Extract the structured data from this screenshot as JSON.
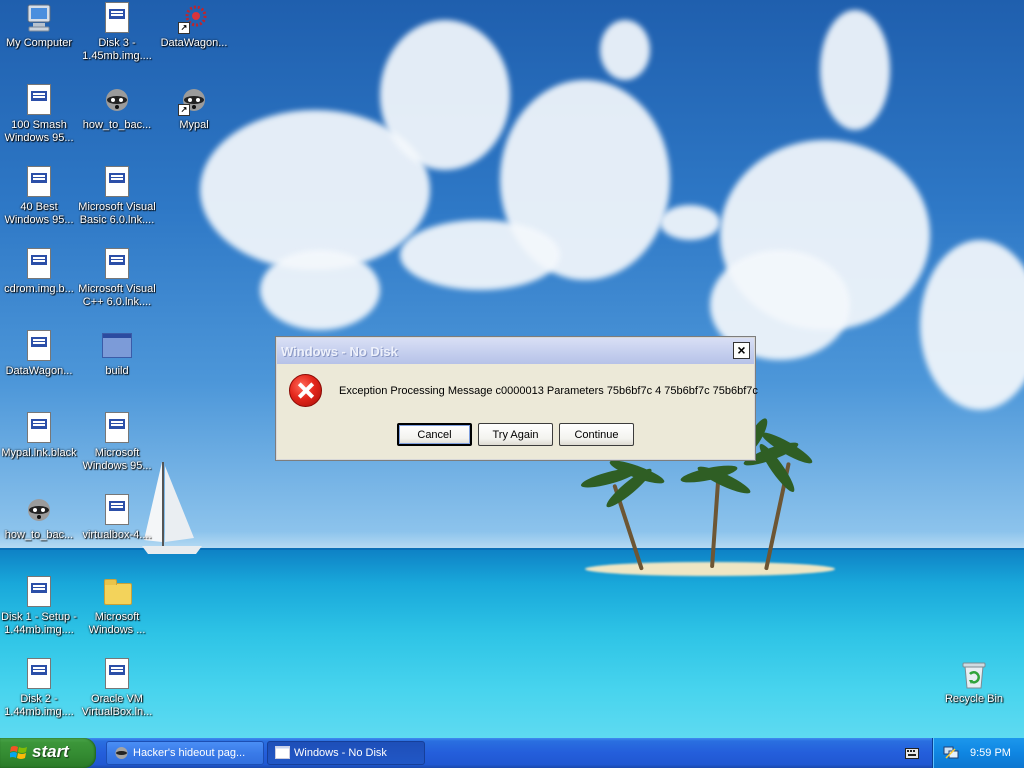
{
  "desktop": {
    "icons": [
      {
        "label": "My Computer",
        "type": "computer"
      },
      {
        "label": "100 Smash\nWindows 95...",
        "type": "doc"
      },
      {
        "label": "40 Best\nWindows 95...",
        "type": "doc"
      },
      {
        "label": "cdrom.img.b...",
        "type": "doc"
      },
      {
        "label": "DataWagon...",
        "type": "doc"
      },
      {
        "label": "Mypal.lnk.black",
        "type": "doc"
      },
      {
        "label": "how_to_bac...",
        "type": "raccoon"
      },
      {
        "label": "Disk 1 - Setup -\n1.44mb.img....",
        "type": "doc"
      },
      {
        "label": "Disk 2 -\n1.44mb.img....",
        "type": "doc"
      },
      {
        "label": "Disk 3 -\n1.45mb.img....",
        "type": "doc"
      },
      {
        "label": "how_to_bac...",
        "type": "raccoon"
      },
      {
        "label": "Microsoft Visual\nBasic 6.0.lnk....",
        "type": "doc"
      },
      {
        "label": "Microsoft Visual\nC++ 6.0.lnk....",
        "type": "doc"
      },
      {
        "label": "build",
        "type": "window"
      },
      {
        "label": "Microsoft\nWindows 95...",
        "type": "doc"
      },
      {
        "label": "virtualbox-4....",
        "type": "doc"
      },
      {
        "label": "Microsoft\nWindows ...",
        "type": "folder"
      },
      {
        "label": "Oracle VM\nVirtualBox.ln...",
        "type": "doc"
      },
      {
        "label": "DataWagon...",
        "type": "firework"
      },
      {
        "label": "Mypal",
        "type": "raccoon"
      },
      {
        "label": "Recycle Bin",
        "type": "recycle"
      }
    ]
  },
  "dialog": {
    "title": "Windows - No Disk",
    "close_label": "×",
    "icon": "error-icon",
    "message": "Exception Processing Message c0000013 Parameters 75b6bf7c 4 75b6bf7c 75b6bf7c",
    "buttons": {
      "cancel": "Cancel",
      "try_again": "Try Again",
      "continue": "Continue"
    }
  },
  "taskbar": {
    "start_label": "start",
    "tasks": [
      {
        "label": "Hacker's hideout pag...",
        "icon": "raccoon-icon"
      },
      {
        "label": "Windows - No Disk",
        "icon": "window-icon"
      }
    ],
    "clock": "9:59 PM"
  },
  "colors": {
    "taskbar_blue": "#245edb",
    "start_green": "#338a31",
    "dialog_face": "#ece9d8",
    "error_red": "#e4271c"
  }
}
